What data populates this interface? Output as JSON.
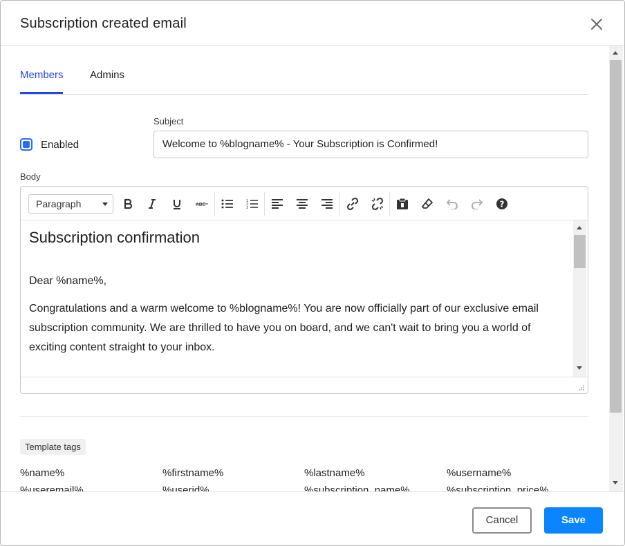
{
  "dialog": {
    "title": "Subscription created email",
    "close_icon": "close-icon"
  },
  "tabs": [
    {
      "label": "Members",
      "active": true
    },
    {
      "label": "Admins",
      "active": false
    }
  ],
  "form": {
    "enabled_label": "Enabled",
    "enabled_checked": true,
    "subject_label": "Subject",
    "subject_value": "Welcome to %blogname% - Your Subscription is Confirmed!",
    "body_label": "Body"
  },
  "editor": {
    "format_select": "Paragraph",
    "toolbar_icons": [
      "bold-icon",
      "italic-icon",
      "underline-icon",
      "strikethrough-icon",
      "bullet-list-icon",
      "numbered-list-icon",
      "align-left-icon",
      "align-center-icon",
      "align-right-icon",
      "link-icon",
      "unlink-icon",
      "paste-icon",
      "clear-format-icon",
      "undo-icon",
      "redo-icon",
      "help-icon"
    ],
    "heading": "Subscription confirmation",
    "greeting": "Dear %name%,",
    "paragraph": "Congratulations and a warm welcome to %blogname%! You are now officially part of our exclusive email subscription community. We are thrilled to have you on board, and we can't wait to bring you a world of exciting content straight to your inbox."
  },
  "template_tags": {
    "label": "Template tags",
    "tags": [
      "%name%",
      "%firstname%",
      "%lastname%",
      "%username%",
      "%useremail%",
      "%userid%",
      "%subscription_name%",
      "%subscription_price%"
    ]
  },
  "footer": {
    "cancel_label": "Cancel",
    "save_label": "Save"
  },
  "colors": {
    "accent": "#2145e6",
    "save_button": "#0a84ff",
    "checkbox": "#2a6cf0"
  }
}
